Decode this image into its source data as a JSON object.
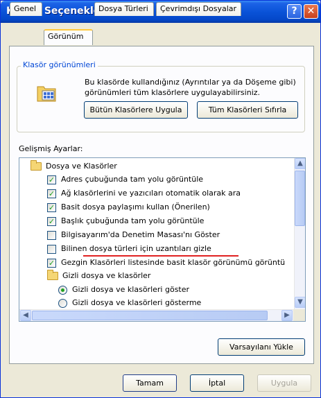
{
  "window": {
    "title": "Klasör Seçenekleri",
    "help_glyph": "?",
    "close_glyph": "✕"
  },
  "tabs": [
    {
      "label": "Genel",
      "active": false
    },
    {
      "label": "Görünüm",
      "active": true
    },
    {
      "label": "Dosya Türleri",
      "active": false
    },
    {
      "label": "Çevrimdışı Dosyalar",
      "active": false
    }
  ],
  "folder_views": {
    "legend": "Klasör görünümleri",
    "description": "Bu klasörde kullandığınız (Ayrıntılar ya da Döşeme gibi) görünümleri tüm klasörlere uygulayabilirsiniz.",
    "apply_all_button": "Bütün Klasörlere Uygula",
    "reset_all_button": "Tüm Klasörleri Sıfırla",
    "icon": "folder-grid-icon"
  },
  "advanced": {
    "label": "Gelişmiş Ayarlar:",
    "items": [
      {
        "type": "folder",
        "label": "Dosya ve Klasörler",
        "indent": 0
      },
      {
        "type": "checkbox",
        "label": "Adres çubuğunda tam yolu görüntüle",
        "checked": true
      },
      {
        "type": "checkbox",
        "label": "Ağ klasörlerini ve yazıcıları otomatik olarak ara",
        "checked": true
      },
      {
        "type": "checkbox",
        "label": "Basit dosya paylaşımı kullan (Önerilen)",
        "checked": true
      },
      {
        "type": "checkbox",
        "label": "Başlık çubuğunda tam yolu görüntüle",
        "checked": true
      },
      {
        "type": "checkbox",
        "label": "Bilgisayarım'da Denetim Masası'nı Göster",
        "checked": false
      },
      {
        "type": "checkbox",
        "label": "Bilinen dosya türleri için uzantıları gizle",
        "checked": false
      },
      {
        "type": "checkbox",
        "label": "Gezgin Klasörleri listesinde basit klasör görünümü görüntü",
        "checked": true
      },
      {
        "type": "folder",
        "label": "Gizli dosya ve klasörler",
        "indent": 1
      },
      {
        "type": "radio",
        "label": "Gizli dosya ve klasörleri göster",
        "selected": true
      },
      {
        "type": "radio",
        "label": "Gizli dosya ve klasörleri gösterme",
        "selected": false
      }
    ],
    "highlight_color": "#e02020"
  },
  "restore_defaults_button": "Varsayılanı Yükle",
  "footer": {
    "ok": "Tamam",
    "cancel": "İptal",
    "apply": "Uygula"
  },
  "colors": {
    "titlebar": "#0a53d8",
    "legend_text": "#0046d5",
    "check_mark": "#21a121"
  }
}
